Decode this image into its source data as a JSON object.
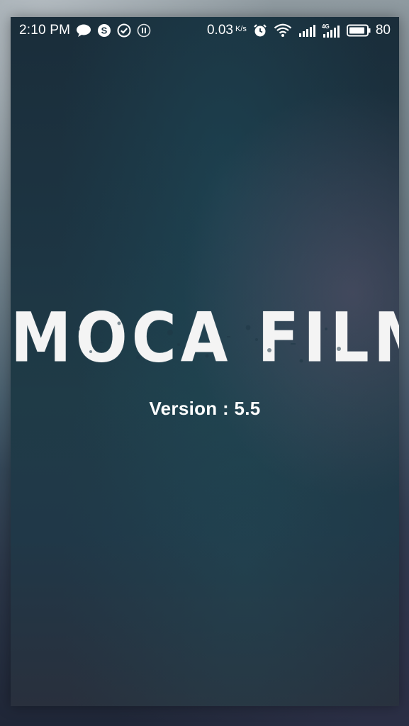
{
  "status_bar": {
    "time": "2:10 PM",
    "left_icons": [
      "chat-bubble-icon",
      "skype-icon",
      "check-circle-icon",
      "pause-circle-icon"
    ],
    "network_speed": "0.03",
    "network_speed_unit": "K/s",
    "right_icons": [
      "alarm-icon",
      "wifi-icon",
      "signal-icon",
      "signal-4g-icon",
      "battery-icon"
    ],
    "network_type": "4G",
    "battery_level": "80"
  },
  "splash": {
    "app_name": "MOCA FILM",
    "version_text": "Version : 5.5"
  },
  "colors": {
    "background_top": "#1a2d3a",
    "background_bottom": "#29303d",
    "text": "#ffffff"
  }
}
